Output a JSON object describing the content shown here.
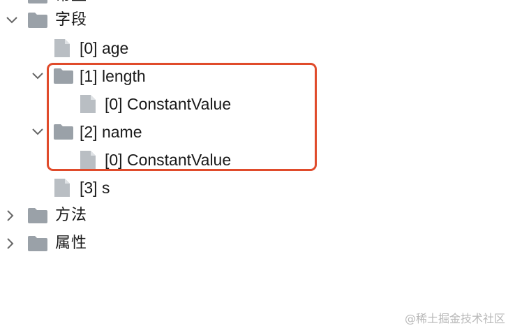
{
  "tree": {
    "partial_top_label": "常量",
    "nodes": [
      {
        "label": "字段",
        "kind": "folder",
        "expanded": true
      },
      {
        "label": "[0] age",
        "kind": "file"
      },
      {
        "label": "[1] length",
        "kind": "folder",
        "expanded": true
      },
      {
        "label": "[0] ConstantValue",
        "kind": "file"
      },
      {
        "label": "[2] name",
        "kind": "folder",
        "expanded": true
      },
      {
        "label": "[0] ConstantValue",
        "kind": "file"
      },
      {
        "label": "[3] s",
        "kind": "file"
      },
      {
        "label": "方法",
        "kind": "folder",
        "expanded": false
      },
      {
        "label": "属性",
        "kind": "folder",
        "expanded": false
      }
    ]
  },
  "watermark": "@稀土掘金技术社区",
  "colors": {
    "folder_icon": "#9aa1a8",
    "file_icon": "#b9bec3",
    "highlight_border": "#e04b2b",
    "chevron": "#666666"
  }
}
